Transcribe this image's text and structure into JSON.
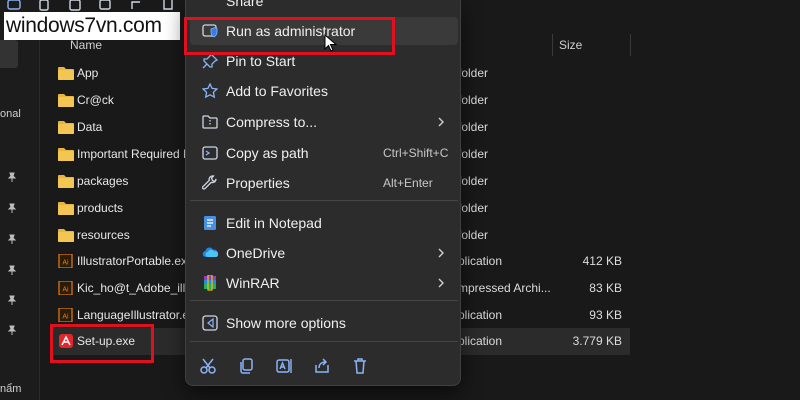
{
  "watermark": "windows7vn.com",
  "nav": {
    "partial_label_1": "onal",
    "partial_label_2": "nẩm"
  },
  "columns": {
    "name": "Name",
    "size": "Size"
  },
  "files": [
    {
      "name": "App",
      "type": "folder",
      "size": "",
      "icon": "folder-icon"
    },
    {
      "name": "Cr@ck",
      "type": "folder",
      "size": "",
      "icon": "folder-icon"
    },
    {
      "name": "Data",
      "type": "folder",
      "size": "",
      "icon": "folder-icon"
    },
    {
      "name": "Important Required R",
      "type": "folder",
      "size": "",
      "icon": "folder-icon"
    },
    {
      "name": "packages",
      "type": "folder",
      "size": "",
      "icon": "folder-icon"
    },
    {
      "name": "products",
      "type": "folder",
      "size": "",
      "icon": "folder-icon"
    },
    {
      "name": "resources",
      "type": "folder",
      "size": "",
      "icon": "folder-icon"
    },
    {
      "name": "IllustratorPortable.exe",
      "type": "plication",
      "size": "412 KB",
      "icon": "illustrator-icon"
    },
    {
      "name": "Kic_ho@t_Adobe_illu",
      "type": "mpressed Archi...",
      "size": "83 KB",
      "icon": "illustrator-icon"
    },
    {
      "name": "LanguageIllustrator.e",
      "type": "plication",
      "size": "93 KB",
      "icon": "illustrator-icon"
    },
    {
      "name": "Set-up.exe",
      "type": "plication",
      "size": "3.779 KB",
      "icon": "adobe-setup-icon"
    }
  ],
  "context_menu": {
    "share": "Share",
    "items": [
      {
        "label": "Run as administrator",
        "shortcut": "",
        "icon": "shield-icon"
      },
      {
        "label": "Pin to Start",
        "shortcut": "",
        "icon": "pin-icon"
      },
      {
        "label": "Add to Favorites",
        "shortcut": "",
        "icon": "star-icon"
      },
      {
        "label": "Compress to...",
        "shortcut": "",
        "icon": "archive-icon",
        "submenu": true
      },
      {
        "label": "Copy as path",
        "shortcut": "Ctrl+Shift+C",
        "icon": "path-icon"
      },
      {
        "label": "Properties",
        "shortcut": "Alt+Enter",
        "icon": "wrench-icon"
      },
      {
        "label": "Edit in Notepad",
        "shortcut": "",
        "icon": "notepad-icon"
      },
      {
        "label": "OneDrive",
        "shortcut": "",
        "icon": "onedrive-icon",
        "submenu": true
      },
      {
        "label": "WinRAR",
        "shortcut": "",
        "icon": "winrar-icon",
        "submenu": true
      },
      {
        "label": "Show more options",
        "shortcut": "",
        "icon": "more-options-icon"
      }
    ],
    "bottom_actions": [
      "cut-icon",
      "copy-icon",
      "rename-icon",
      "share-icon",
      "delete-icon"
    ]
  },
  "colors": {
    "highlight_box": "#e0101f",
    "folder": "#e8b43c",
    "accent": "#8ab4f8"
  }
}
